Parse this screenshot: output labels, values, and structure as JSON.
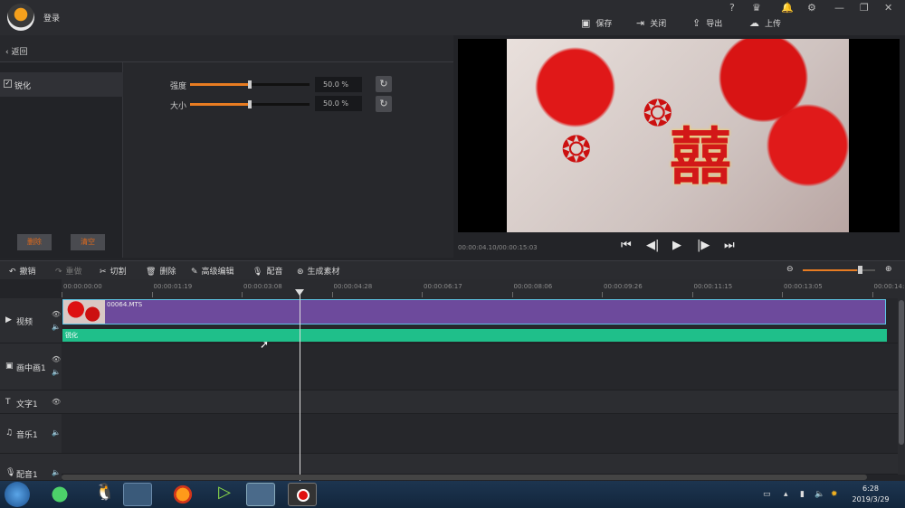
{
  "topbar": {
    "login": "登录",
    "icons": [
      "help-icon",
      "shop-icon",
      "bell-icon",
      "gear-icon",
      "minimize-icon",
      "restore-icon",
      "close-icon"
    ],
    "help": "?",
    "actions": [
      {
        "label": "保存",
        "icon": "save-icon",
        "glyph": "▣"
      },
      {
        "label": "关闭",
        "icon": "exit-icon",
        "glyph": "⇥"
      },
      {
        "label": "导出",
        "icon": "export-icon",
        "glyph": "⇪"
      },
      {
        "label": "上传",
        "icon": "upload-icon",
        "glyph": "☁"
      }
    ]
  },
  "left": {
    "back": "返回",
    "effect": "锐化",
    "delete": "删除",
    "clear": "清空",
    "sliders": [
      {
        "label": "强度",
        "value": "50.0 %",
        "level": 0.5
      },
      {
        "label": "大小",
        "value": "50.0 %",
        "level": 0.5
      }
    ]
  },
  "preview": {
    "time": "00:00:04.10/00:00:15:03",
    "xi": "囍"
  },
  "toolbar": {
    "undo": "撤销",
    "redo": "重做",
    "cut": "切割",
    "delete": "删除",
    "advanced": "高级编辑",
    "dub": "配音",
    "generate": "生成素材",
    "zoom_level": 0.75
  },
  "ruler": [
    "00:00:00:00",
    "00:00:01:19",
    "00:00:03:08",
    "00:00:04:28",
    "00:00:06:17",
    "00:00:08:06",
    "00:00:09:26",
    "00:00:11:15",
    "00:00:13:05",
    "00:00:14:"
  ],
  "tracks": {
    "video": "视频",
    "pip": "画中画1",
    "text": "文字1",
    "music": "音乐1",
    "voice": "配音1"
  },
  "clips": {
    "video_name": "00064.MTS",
    "fx_name": "锐化"
  },
  "taskbar": {
    "time": "6:28",
    "date": "2019/3/29"
  },
  "colors": {
    "accent": "#e87c22",
    "clip_video": "#6d4a9c",
    "clip_fx": "#1fbf8a"
  }
}
